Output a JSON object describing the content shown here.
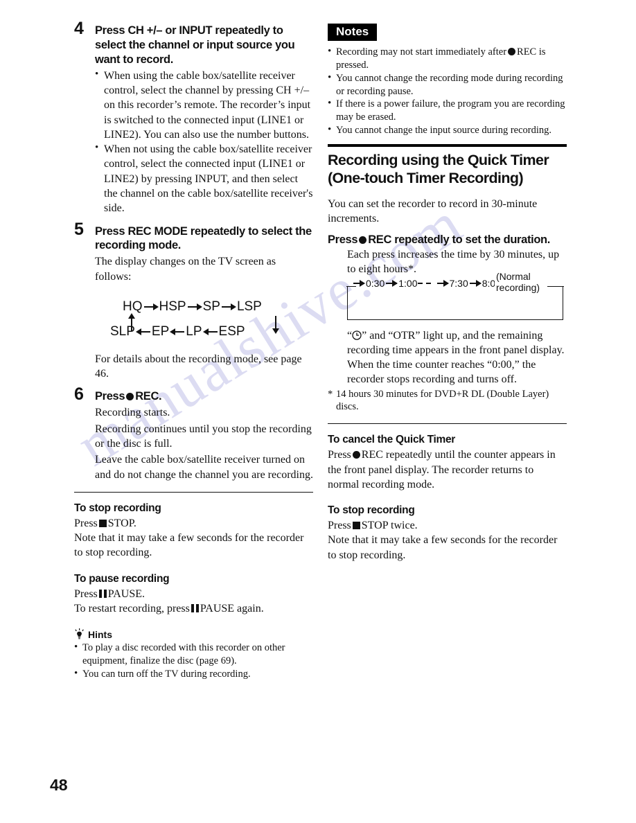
{
  "page": {
    "number": "48",
    "watermark": "manualshive.com"
  },
  "left_column": {
    "step4": {
      "number": "4",
      "heading": "Press CH +/– or INPUT repeatedly to select the channel or input source you want to record.",
      "bullets": [
        "When using the cable box/satellite receiver control, select the channel by pressing CH +/– on this recorder’s remote. The recorder’s input is switched to the connected input (LINE1 or LINE2). You can also use the number buttons.",
        "When not using the cable box/satellite receiver control, select the connected input (LINE1 or LINE2) by pressing INPUT, and then select the channel on the cable box/satellite receiver's side."
      ]
    },
    "step5": {
      "number": "5",
      "heading": "Press REC MODE repeatedly to select the recording mode.",
      "text": "The display changes on the TV screen as follows:",
      "after_text": "For details about the recording mode, see page 46."
    },
    "recmode_cycle": {
      "row1": [
        "HQ",
        "HSP",
        "SP",
        "LSP"
      ],
      "row2": [
        "SLP",
        "EP",
        "LP",
        "ESP"
      ]
    },
    "step6": {
      "number": "6",
      "heading_prefix": "Press",
      "heading_suffix": "REC.",
      "lines": [
        "Recording starts.",
        "Recording continues until you stop the recording or the disc is full.",
        "Leave the cable box/satellite receiver turned on and do not change the channel you are recording."
      ]
    },
    "stop_recording": {
      "heading": "To stop recording",
      "press_prefix": "Press",
      "press_suffix": "STOP.",
      "note": "Note that it may take a few seconds for the recorder to stop recording."
    },
    "pause_recording": {
      "heading": "To pause recording",
      "press_prefix": "Press",
      "press_suffix": "PAUSE.",
      "restart_prefix": "To restart recording, press",
      "restart_suffix": "PAUSE again."
    },
    "hints": {
      "heading": "Hints",
      "items": [
        "To play a disc recorded with this recorder on other equipment, finalize the disc (page 69).",
        "You can turn off the TV during recording."
      ]
    }
  },
  "right_column": {
    "notes": {
      "tag": "Notes",
      "items_parts": [
        {
          "before": "Recording may not start immediately after",
          "after": "REC is pressed.",
          "icon": "rec-circle-icon"
        },
        {
          "before": "You cannot change the recording mode during recording or recording pause.",
          "after": "",
          "icon": ""
        },
        {
          "before": "If there is a power failure, the program you are recording may be erased.",
          "after": "",
          "icon": ""
        },
        {
          "before": "You cannot change the input source during recording.",
          "after": "",
          "icon": ""
        }
      ]
    },
    "section": {
      "title": "Recording using the Quick Timer (One-touch Timer Recording)",
      "intro": "You can set the recorder to record in 30-minute increments.",
      "press_heading_prefix": "Press",
      "press_heading_suffix": "REC repeatedly to set the duration.",
      "press_body": "Each press increases the time by 30 minutes, up to eight hours*.",
      "after_diagram_1_prefix": "“",
      "after_diagram_1_suffix": "” and “OTR” light up, and the remaining recording time appears in the front panel display.",
      "after_diagram_2": "When the time counter reaches “0:00,” the recorder stops recording and turns off.",
      "footnote_star": "*",
      "footnote": "14 hours 30 minutes for DVD+R DL (Double Layer) discs."
    },
    "timer_cycle": {
      "values": [
        "0:30",
        "1:00",
        "7:30",
        "8:00"
      ],
      "end_label_line1": "(Normal",
      "end_label_line2": "recording)"
    },
    "cancel_timer": {
      "heading": "To cancel the Quick Timer",
      "press_prefix": "Press",
      "press_suffix": "REC repeatedly until the counter appears in the front panel display. The recorder returns to normal recording mode."
    },
    "stop_recording": {
      "heading": "To stop recording",
      "press_prefix": "Press",
      "press_suffix": "STOP twice.",
      "note": "Note that it may take a few seconds for the recorder to stop recording."
    }
  }
}
